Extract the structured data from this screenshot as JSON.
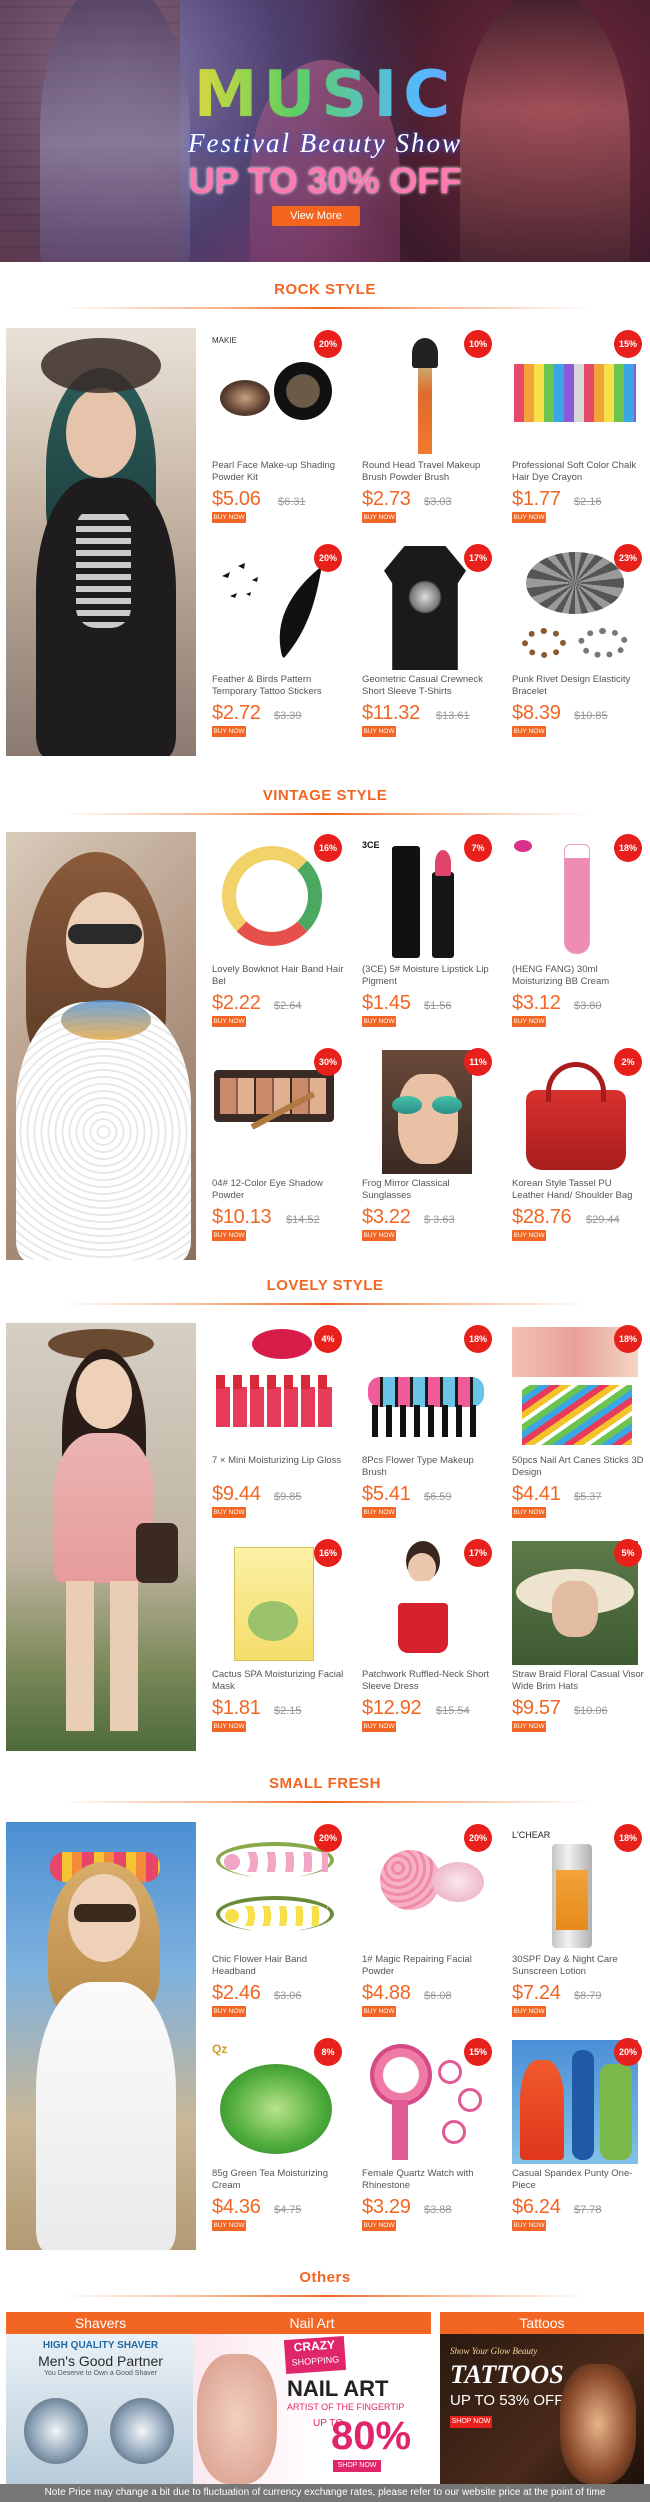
{
  "hero": {
    "title": "MUSIC",
    "subtitle": "Festival Beauty Show",
    "offer": "UP TO 30% OFF",
    "button": "View More"
  },
  "buy_label": "BUY NOW",
  "sections": [
    {
      "title": "ROCK STYLE",
      "products": [
        {
          "name": "Pearl Face Make-up Shading Powder Kit",
          "price": "$5.06",
          "old": "$6.31",
          "badge": "20%",
          "brand": "MAKIE"
        },
        {
          "name": "Round Head Travel Makeup Brush Powder Brush",
          "price": "$2.73",
          "old": "$3.03",
          "badge": "10%"
        },
        {
          "name": "Professional Soft Color Chalk Hair Dye Crayon",
          "price": "$1.77",
          "old": "$2.16",
          "badge": "15%"
        },
        {
          "name": "Feather & Birds Pattern Temporary Tattoo Stickers",
          "price": "$2.72",
          "old": "$3.39",
          "badge": "20%"
        },
        {
          "name": "Geometric Casual Crewneck Short Sleeve T-Shirts",
          "price": "$11.32",
          "old": "$13.61",
          "badge": "17%"
        },
        {
          "name": "Punk Rivet Design Elasticity Bracelet",
          "price": "$8.39",
          "old": "$10.85",
          "badge": "23%"
        }
      ]
    },
    {
      "title": "VINTAGE STYLE",
      "products": [
        {
          "name": "Lovely Bowknot Hair Band Hair Bel",
          "price": "$2.22",
          "old": "$2.64",
          "badge": "16%"
        },
        {
          "name": "(3CE) 5# Moisture Lipstick Lip Pigment",
          "price": "$1.45",
          "old": "$1.56",
          "badge": "7%",
          "brand": "3CE"
        },
        {
          "name": "(HENG FANG) 30ml Moisturizing BB Cream",
          "price": "$3.12",
          "old": "$3.80",
          "badge": "18%"
        },
        {
          "name": "04# 12-Color Eye Shadow Powder",
          "price": "$10.13",
          "old": "$14.52",
          "badge": "30%"
        },
        {
          "name": "Frog Mirror   Classical Sunglasses",
          "price": "$3.22",
          "old": "$ 3.63",
          "badge": "11%"
        },
        {
          "name": "Korean Style Tassel PU Leather Hand/ Shoulder Bag",
          "price": "$28.76",
          "old": "$29.44",
          "badge": "2%"
        }
      ]
    },
    {
      "title": "LOVELY STYLE",
      "products": [
        {
          "name": "7 × Mini Moisturizing Lip Gloss",
          "price": "$9.44",
          "old": "$9.85",
          "badge": "4%"
        },
        {
          "name": "8Pcs Flower Type  Makeup Brush",
          "price": "$5.41",
          "old": "$6.59",
          "badge": "18%"
        },
        {
          "name": "50pcs Nail Art Canes Sticks 3D Design",
          "price": "$4.41",
          "old": "$5.37",
          "badge": "18%"
        },
        {
          "name": "Cactus SPA Moisturizing Facial Mask",
          "price": "$1.81",
          "old": "$2.15",
          "badge": "16%"
        },
        {
          "name": "Patchwork Ruffled-Neck Short Sleeve Dress",
          "price": "$12.92",
          "old": "$15.54",
          "badge": "17%"
        },
        {
          "name": "Straw Braid Floral Casual Visor Wide Brim Hats",
          "price": "$9.57",
          "old": "$10.06",
          "badge": "5%"
        }
      ]
    },
    {
      "title": "SMALL FRESH",
      "products": [
        {
          "name": "Chic Flower Hair Band Headband",
          "price": "$2.46",
          "old": "$3.06",
          "badge": "20%"
        },
        {
          "name": "1# Magic Repairing Facial Powder",
          "price": "$4.88",
          "old": "$6.08",
          "badge": "20%"
        },
        {
          "name": "30SPF Day & Night Care Sunscreen Lotion",
          "price": "$7.24",
          "old": "$8.79",
          "badge": "18%",
          "brand": "L'CHEAR"
        },
        {
          "name": "85g Green Tea Moisturizing Cream",
          "price": "$4.36",
          "old": "$4.75",
          "badge": "8%"
        },
        {
          "name": "Female Quartz Watch with Rhinestone",
          "price": "$3.29",
          "old": "$3.88",
          "badge": "15%"
        },
        {
          "name": "Casual Spandex Punty One-Piece",
          "price": "$6.24",
          "old": "$7.78",
          "badge": "20%"
        }
      ]
    }
  ],
  "others": {
    "title": "Others",
    "tiles": [
      {
        "label": "Shavers",
        "line1": "HIGH QUALITY SHAVER",
        "line2": "Men's Good Partner",
        "line3": "You Deserve to Own a Good Shaver"
      },
      {
        "label": "Nail Art",
        "line1": "CRAZY",
        "line2": "SHOPPING",
        "line3": "NAIL ART",
        "line4": "ARTIST OF THE FINGERTIP",
        "line5": "UP TO",
        "line6": "80%",
        "line7": "SHOP NOW"
      },
      {
        "label": "Tattoos",
        "line1": "Show Your Glow Beauty",
        "line2": "TATTOOS",
        "line3": "UP TO 53% OFF",
        "line4": "SHOP NOW"
      }
    ]
  },
  "footer": "Note Price may change a bit due to fluctuation of currency exchange rates, please refer to our website price at the point of time"
}
